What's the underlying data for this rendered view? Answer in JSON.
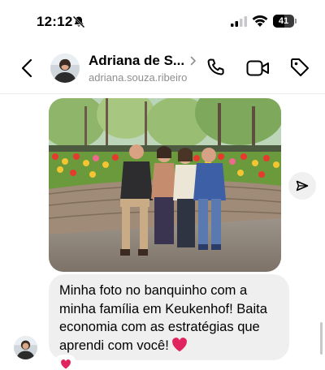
{
  "status_bar": {
    "time": "12:12",
    "battery_level": "41",
    "silent_icon": "bell-slash-icon",
    "signal_icon": "cellular-signal-icon",
    "wifi_icon": "wifi-icon"
  },
  "header": {
    "back_icon": "chevron-left-icon",
    "contact_name": "Adriana de S...",
    "contact_handle": "adriana.souza.ribeiro",
    "name_chevron_icon": "chevron-right-icon",
    "call_icon": "phone-icon",
    "video_icon": "video-camera-icon",
    "tag_icon": "tag-icon"
  },
  "messages": {
    "photo_description_icon": "photo-attachment",
    "share_icon": "paper-plane-icon",
    "text": "Minha foto no banquinho com a minha família em Keukenhof! Baita economia com as estratégias que aprendi com você!",
    "text_emoji": "heart-emoji",
    "reaction_emoji": "heart-emoji"
  },
  "colors": {
    "bubble_background": "#efefef",
    "secondary_text": "#8e8e93",
    "heart": "#e0245e"
  }
}
